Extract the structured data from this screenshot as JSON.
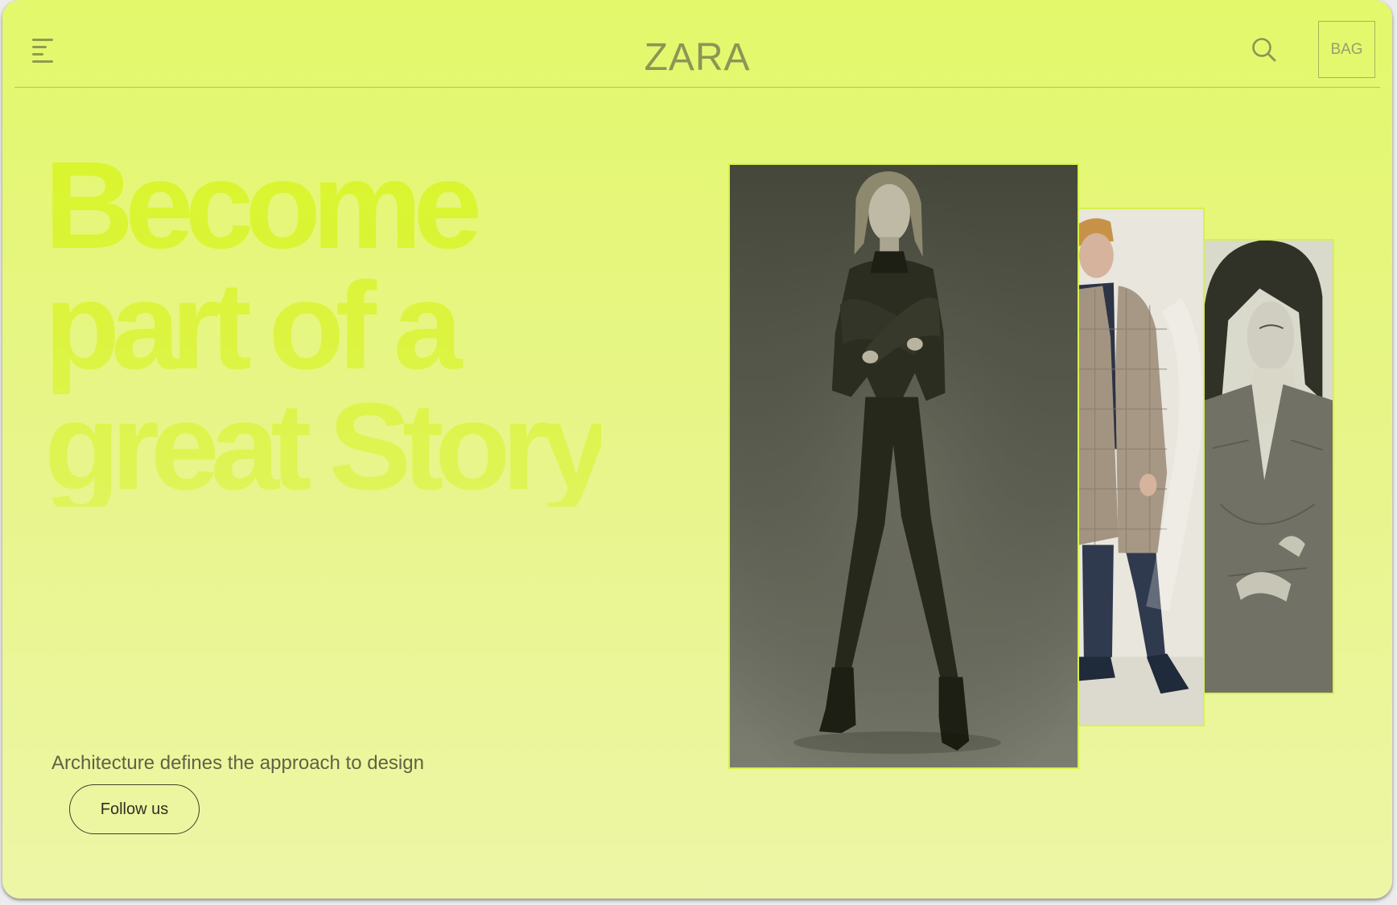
{
  "header": {
    "logo": "ZARA",
    "bag_label": "BAG"
  },
  "icons": {
    "menu": "hamburger-menu-icon",
    "search": "search-icon"
  },
  "hero": {
    "title_lines": [
      "Become",
      "part of a",
      "great Story"
    ],
    "tagline": "Architecture defines the approach to design",
    "cta_label": "Follow us"
  },
  "gallery": {
    "images": [
      {
        "name": "woman-leather-jacket",
        "tone": "monochrome"
      },
      {
        "name": "man-check-coat",
        "tone": "color"
      },
      {
        "name": "woman-denim-jacket",
        "tone": "monochrome"
      }
    ]
  },
  "colors": {
    "background": "#e3f86a",
    "headline": "#d9f52c",
    "photo_border": "#d6f24a",
    "text": "#5f6246"
  }
}
